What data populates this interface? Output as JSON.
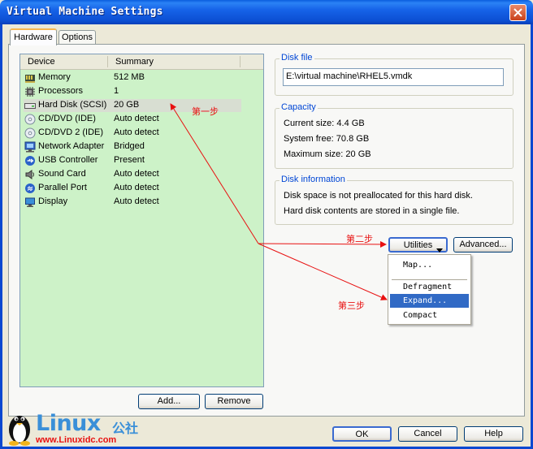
{
  "window": {
    "title": "Virtual Machine Settings",
    "close_icon": "close-icon"
  },
  "tabs": [
    {
      "label": "Hardware",
      "active": true
    },
    {
      "label": "Options",
      "active": false
    }
  ],
  "device_list": {
    "columns": [
      "Device",
      "Summary"
    ],
    "rows": [
      {
        "name": "Memory",
        "summary": "512 MB",
        "icon": "memory-icon"
      },
      {
        "name": "Processors",
        "summary": "1",
        "icon": "processor-icon"
      },
      {
        "name": "Hard Disk (SCSI)",
        "summary": "20 GB",
        "icon": "hard-disk-icon",
        "selected": true
      },
      {
        "name": "CD/DVD (IDE)",
        "summary": "Auto detect",
        "icon": "cd-dvd-icon"
      },
      {
        "name": "CD/DVD 2 (IDE)",
        "summary": "Auto detect",
        "icon": "cd-dvd-icon"
      },
      {
        "name": "Network Adapter",
        "summary": "Bridged",
        "icon": "network-adapter-icon"
      },
      {
        "name": "USB Controller",
        "summary": "Present",
        "icon": "usb-icon"
      },
      {
        "name": "Sound Card",
        "summary": "Auto detect",
        "icon": "sound-card-icon"
      },
      {
        "name": "Parallel Port",
        "summary": "Auto detect",
        "icon": "parallel-port-icon"
      },
      {
        "name": "Display",
        "summary": "Auto detect",
        "icon": "display-icon"
      }
    ]
  },
  "list_buttons": {
    "add": "Add...",
    "remove": "Remove"
  },
  "disk_file": {
    "label": "Disk file",
    "value": "E:\\virtual machine\\RHEL5.vmdk"
  },
  "capacity": {
    "label": "Capacity",
    "current": "Current size: 4.4 GB",
    "free": "System free: 70.8 GB",
    "max": "Maximum size: 20 GB"
  },
  "disk_info": {
    "label": "Disk information",
    "line1": "Disk space is not preallocated for this hard disk.",
    "line2": "Hard disk contents are stored in a single file."
  },
  "utilities": {
    "label": "Utilities",
    "advanced": "Advanced..."
  },
  "utilities_menu": {
    "items": [
      {
        "label": "Map...",
        "highlighted": false
      },
      {
        "label": "Defragment",
        "highlighted": false
      },
      {
        "label": "Expand...",
        "highlighted": true
      },
      {
        "label": "Compact",
        "highlighted": false
      }
    ]
  },
  "annotations": {
    "step1": "第一步",
    "step2": "第二步",
    "step3": "第三步",
    "color": "#e81010"
  },
  "footer_buttons": {
    "ok": "OK",
    "cancel": "Cancel",
    "help": "Help"
  },
  "watermark": {
    "brand": "Linux",
    "brand_cn": "公社",
    "url": "www.Linuxidc.com"
  },
  "colors": {
    "titlebar": "#0c4fd3",
    "list_background": "#cdf2c8",
    "group_label": "#0046d5",
    "menu_highlight": "#316ac5"
  }
}
